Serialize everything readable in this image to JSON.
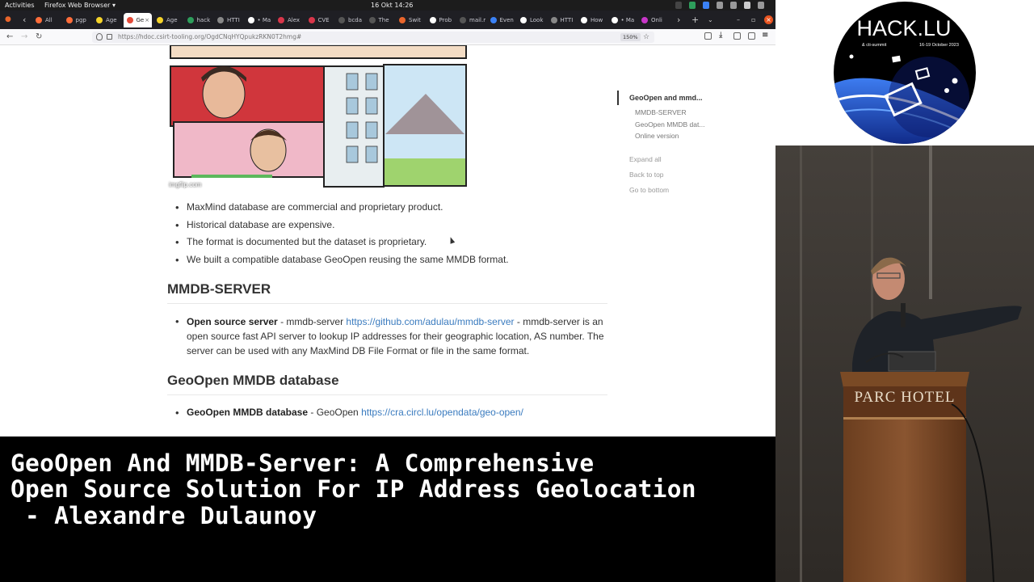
{
  "system_bar": {
    "activities": "Activities",
    "app": "Firefox Web Browser ▾",
    "clock": "16 Okt  14:26"
  },
  "tabs": [
    {
      "label": "All",
      "color": "#ff6d3a"
    },
    {
      "label": "pgp",
      "color": "#ff6d3a"
    },
    {
      "label": "Age",
      "color": "#f5d32a"
    },
    {
      "label": "Ge",
      "color": "#e44b3a",
      "active": true
    },
    {
      "label": "Age",
      "color": "#f5d32a"
    },
    {
      "label": "hack",
      "color": "#2e9e5b"
    },
    {
      "label": "HTTI",
      "color": "#888888"
    },
    {
      "label": "• Ma",
      "color": "#ffffff"
    },
    {
      "label": "Alex",
      "color": "#d9364a"
    },
    {
      "label": "CVE",
      "color": "#d9364a"
    },
    {
      "label": "bcda",
      "color": "#555555"
    },
    {
      "label": "The",
      "color": "#555555"
    },
    {
      "label": "Swit",
      "color": "#e9652b"
    },
    {
      "label": "Prob",
      "color": "#ffffff"
    },
    {
      "label": "mail.mb",
      "color": "#555555"
    },
    {
      "label": "Even",
      "color": "#3b82f6"
    },
    {
      "label": "Look",
      "color": "#ffffff"
    },
    {
      "label": "HTTI",
      "color": "#888888"
    },
    {
      "label": "How",
      "color": "#ffffff"
    },
    {
      "label": "• Ma",
      "color": "#ffffff"
    },
    {
      "label": "Onli",
      "color": "#c836c8"
    }
  ],
  "nav": {
    "url": "https://hdoc.csirt-tooling.org/OgdCNqHYQpukzRKN0T2hmg#",
    "zoom": "150%"
  },
  "comic_watermark": "imgflip.com",
  "bullets": [
    "MaxMind database are commercial and proprietary product.",
    "Historical database are expensive.",
    "The format is documented but the dataset is proprietary.",
    "We built a compatible database GeoOpen reusing the same MMDB format."
  ],
  "section1": {
    "heading": "MMDB-SERVER",
    "bold": "Open source server",
    "pre": " - mmdb-server ",
    "link": "https://github.com/adulau/mmdb-server",
    "post": " - mmdb-server is an open source fast API server to lookup IP addresses for their geographic location, AS number. The server can be used with any MaxMind DB File Format or file in the same format."
  },
  "section2": {
    "heading": "GeoOpen MMDB database",
    "bold": "GeoOpen MMDB database",
    "pre": " - GeoOpen ",
    "link": "https://cra.circl.lu/opendata/geo-open/"
  },
  "toc": {
    "active": "GeoOpen and mmd...",
    "items": [
      "MMDB-SERVER",
      "GeoOpen MMDB dat...",
      "Online version"
    ],
    "expand": "Expand all",
    "top": "Back to top",
    "bottom": "Go to bottom"
  },
  "caption": {
    "line1": "GeoOpen And MMDB-Server: A Comprehensive",
    "line2": "Open Source Solution For IP Address Geolocation",
    "line3": " - Alexandre Dulaunoy"
  },
  "logo": {
    "title": "HACK.LU",
    "subtitle": "& cti-summit",
    "dates": "16-19 October 2023"
  },
  "podium_text": "PARC HOTEL",
  "colors": {
    "link": "#3a7bbf",
    "accent_blue": "#1b3fa0"
  }
}
